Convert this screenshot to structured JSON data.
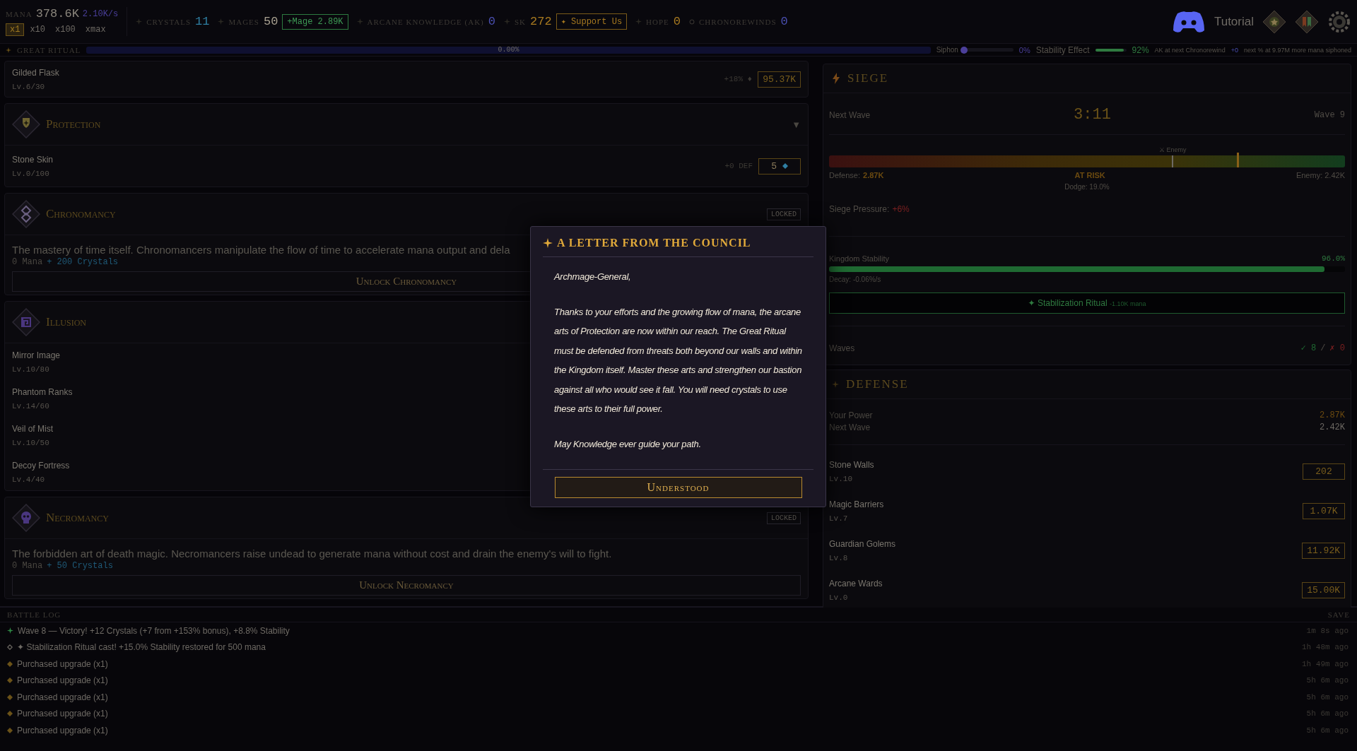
{
  "top_bar": {
    "mana": {
      "label": "MANA",
      "value": "378.6K",
      "rate": "2.10K/s"
    },
    "multipliers": [
      {
        "label": "x1",
        "selected": true
      },
      {
        "label": "x10",
        "selected": false
      },
      {
        "label": "x100",
        "selected": false
      },
      {
        "label": "xmax",
        "selected": false
      }
    ],
    "stats": [
      {
        "label": "CRYSTALS",
        "value": "11",
        "color": "#2f7fa3"
      },
      {
        "label": "MAGES",
        "value": "50",
        "color": "#a8a090",
        "action": {
          "label": "+Mage 2.89K",
          "kind": "green"
        }
      },
      {
        "label": "ARCANE KNOWLEDGE (AK)",
        "value": "0",
        "color": "#4a4fb0"
      },
      {
        "label": "SK",
        "value": "272",
        "color": "#a87a20",
        "action": {
          "label": "✦ Support Us",
          "kind": "gold"
        }
      },
      {
        "label": "HOPE",
        "value": "0",
        "color": "#a87a20"
      },
      {
        "label": "CHRONOREWINDS",
        "value": "0",
        "color": "#4a4fb0",
        "kind": "rewind"
      }
    ],
    "tutorial": "Tutorial"
  },
  "ritual": {
    "label": "GREAT RITUAL",
    "level": 0,
    "reading": "0.00%",
    "siphon": {
      "label": "Siphon",
      "level": 0,
      "reading": "0%"
    },
    "stability_effect": {
      "label": "Stability Effect",
      "level": 0.92,
      "reading": "92%"
    },
    "note_prefix": "AK at next Chronorewind",
    "note_value": "+0",
    "note_suffix": "next % at 9.97M more mana siphoned"
  },
  "upgrades_top": [
    {
      "name": "Gilded Flask",
      "level": "Lv.6/30",
      "effect": "+18% ♦",
      "cost": "95.37K",
      "kind": "mana"
    }
  ],
  "schools": [
    {
      "kind": "unlocked",
      "title": "Protection",
      "toggle": "▼",
      "upgrades": [
        {
          "name": "Stone Skin",
          "level": "Lv.0/100",
          "effect": "+0 DEF",
          "cost": "5",
          "kind": "crystal"
        }
      ]
    },
    {
      "kind": "locked",
      "title": "Chronomancy",
      "badge": "LOCKED",
      "description": "The mastery of time itself. Chronomancers manipulate the flow of time to accelerate mana output and dela",
      "mana_cost": "0 Mana",
      "crystal_cost": "+ 200 Crystals",
      "button": "Unlock Chronomancy"
    },
    {
      "kind": "unlocked",
      "title": "Illusion",
      "upgrades": [
        {
          "name": "Mirror Image",
          "level": "Lv.10/80"
        },
        {
          "name": "Phantom Ranks",
          "level": "Lv.14/60"
        },
        {
          "name": "Veil of Mist",
          "level": "Lv.10/50"
        },
        {
          "name": "Decoy Fortress",
          "level": "Lv.4/40"
        }
      ]
    },
    {
      "kind": "locked",
      "title": "Necromancy",
      "badge": "LOCKED",
      "description": "The forbidden art of death magic. Necromancers raise undead to generate mana without cost and drain the enemy's will to fight.",
      "mana_cost": "0 Mana",
      "crystal_cost": "+ 50 Crystals",
      "button": "Unlock Necromancy"
    }
  ],
  "siege": {
    "title": "SIEGE",
    "next_wave_label": "Next Wave",
    "timer": "3:11",
    "wave": "Wave 9",
    "enemy_marker": {
      "label": "⚔ Enemy",
      "level": 0.666
    },
    "defense_marker": {
      "level": 0.792
    },
    "defense_label": "Defense:",
    "defense_value": "2.87K",
    "status": "AT RISK",
    "enemy_text": "Enemy: 2.42K",
    "dodge": "Dodge: 19.0%",
    "pressure_label": "Siege Pressure:",
    "pressure_value": "+6%",
    "stability": {
      "label": "Kingdom Stability",
      "reading": "96.0%",
      "level": 0.96,
      "decay": "Decay: -0.06%/s"
    },
    "ritual_button": {
      "label": "✦ Stabilization Ritual",
      "cost": "-1.10K mana"
    },
    "waves_label": "Waves",
    "wins": "✓ 8",
    "separator": "/",
    "losses": "✗ 0"
  },
  "defense": {
    "title": "DEFENSE",
    "power_label": "Your Power",
    "power_value": "2.87K",
    "next_label": "Next Wave",
    "next_value": "2.42K",
    "items": [
      {
        "name": "Stone Walls",
        "level": "Lv.10",
        "cost": "202"
      },
      {
        "name": "Magic Barriers",
        "level": "Lv.7",
        "cost": "1.07K"
      },
      {
        "name": "Guardian Golems",
        "level": "Lv.8",
        "cost": "11.92K"
      },
      {
        "name": "Arcane Wards",
        "level": "Lv.0",
        "cost": "15.00K"
      }
    ]
  },
  "battle_log": {
    "title": "BATTLE LOG",
    "save": "SAVE",
    "entries": [
      {
        "kind": "victory",
        "text": "Wave 8 — Victory! +12 Crystals (+7 from +153% bonus), +8.8% Stability",
        "time": "1m 8s ago"
      },
      {
        "kind": "ritual",
        "text": "✦ Stabilization Ritual cast! +15.0% Stability restored for 500 mana",
        "time": "1h 48m ago"
      },
      {
        "kind": "upgrade",
        "text": "Purchased upgrade (x1)",
        "time": "1h 49m ago"
      },
      {
        "kind": "upgrade",
        "text": "Purchased upgrade (x1)",
        "time": "5h 6m ago"
      },
      {
        "kind": "upgrade",
        "text": "Purchased upgrade (x1)",
        "time": "5h 6m ago"
      },
      {
        "kind": "upgrade",
        "text": "Purchased upgrade (x1)",
        "time": "5h 6m ago"
      },
      {
        "kind": "upgrade",
        "text": "Purchased upgrade (x1)",
        "time": "5h 6m ago"
      }
    ]
  },
  "modal": {
    "title": "A LETTER FROM THE COUNCIL",
    "paragraphs": [
      "Archmage-General,",
      "Thanks to your efforts and the growing flow of mana, the arcane arts of Protection are now within our reach. The Great Ritual must be defended from threats both beyond our walls and within the Kingdom itself. Master these arts and strengthen our bastion against all who would see it fall. You will need crystals to use these arts to their full power.",
      "May Knowledge ever guide your path."
    ],
    "button": "Understood"
  }
}
